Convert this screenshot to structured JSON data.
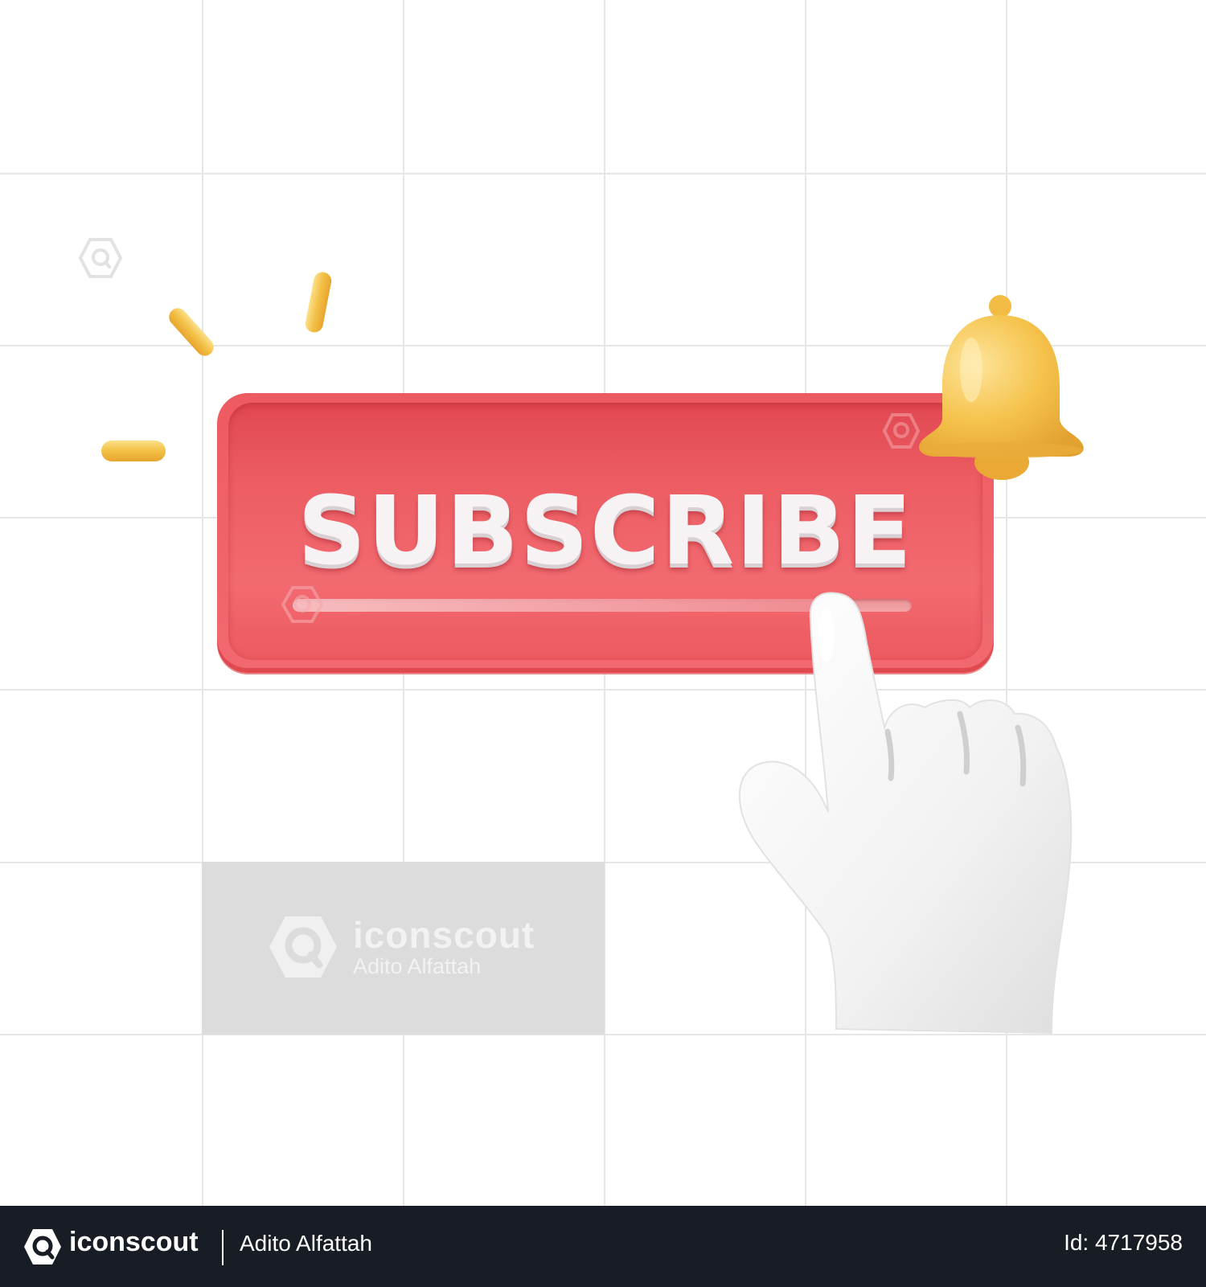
{
  "illustration": {
    "button_label": "SUBSCRIBE",
    "progress_fraction": 0.85,
    "colors": {
      "button_red": "#ef5f66",
      "bell_gold": "#f5c24b",
      "hand_white": "#f4f4f4",
      "grid_line": "#e6e6e6"
    },
    "icons": [
      "bell-icon",
      "pointing-hand-icon",
      "sparkle-dash-icon"
    ]
  },
  "watermark": {
    "brand": "iconscout",
    "author": "Adito Alfattah"
  },
  "footer": {
    "brand": "iconscout",
    "author": "Adito Alfattah",
    "id_text": "Id: 4717958",
    "background": "#181c24"
  }
}
